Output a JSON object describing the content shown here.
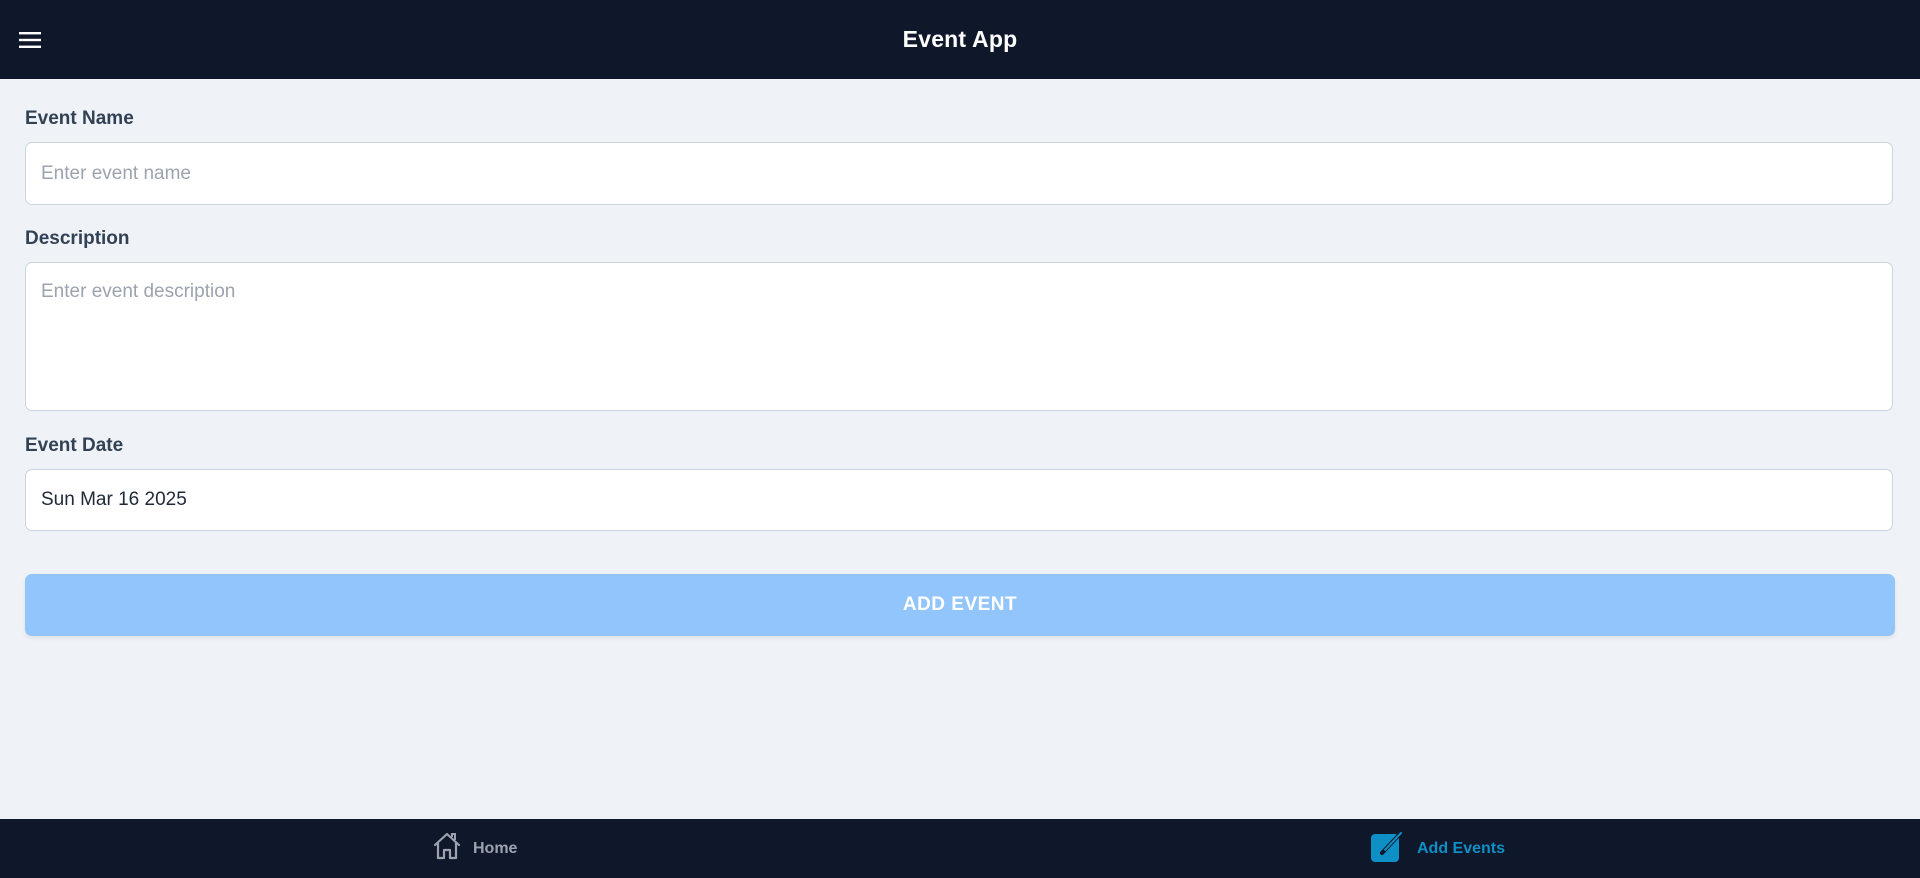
{
  "header": {
    "title": "Event App",
    "menu_icon": "hamburger-menu-icon"
  },
  "form": {
    "name_label": "Event Name",
    "name_placeholder": "Enter event name",
    "name_value": "",
    "description_label": "Description",
    "description_placeholder": "Enter event description",
    "description_value": "",
    "date_label": "Event Date",
    "date_value": "Sun Mar 16 2025",
    "submit_label": "ADD EVENT"
  },
  "bottom_nav": {
    "items": [
      {
        "label": "Home",
        "icon": "home-icon",
        "active": false
      },
      {
        "label": "Add Events",
        "icon": "edit-icon",
        "active": true
      }
    ]
  },
  "colors": {
    "header_bg": "#0f172a",
    "page_bg": "#eff3f8",
    "submit_bg": "#93c5fd",
    "active_nav": "#0e8fc5",
    "inactive_nav": "#9ca3af"
  }
}
